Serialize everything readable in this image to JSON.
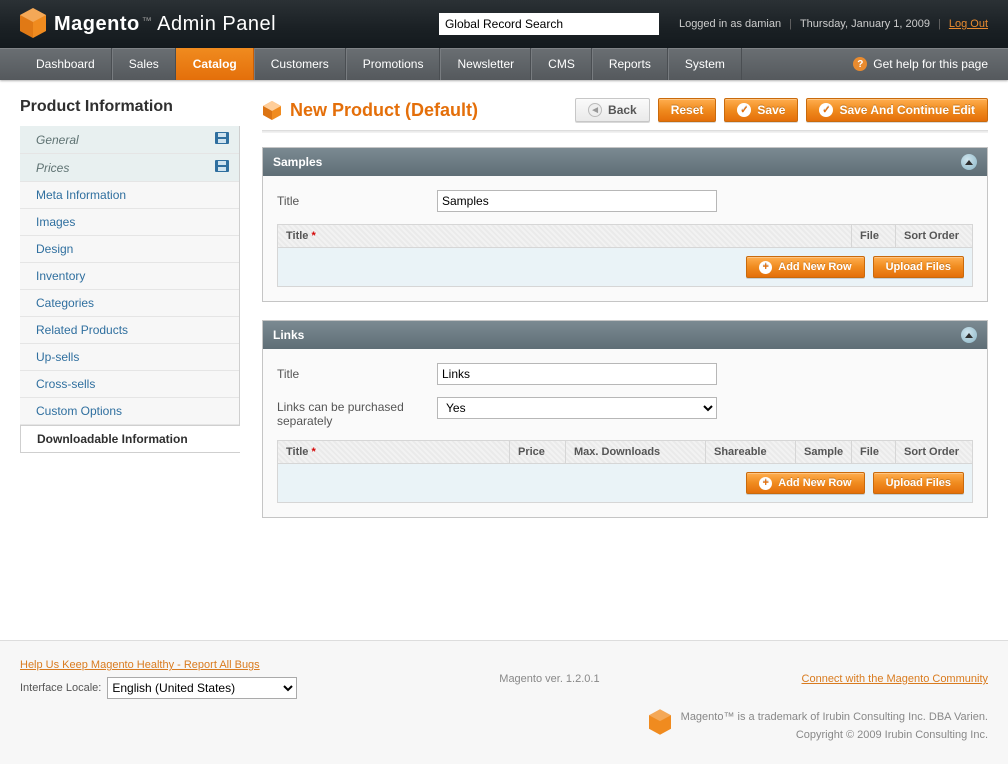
{
  "header": {
    "brand_main": "Magento",
    "brand_sub": "Admin Panel",
    "tm": "™",
    "search_placeholder": "Global Record Search",
    "logged_in_prefix": "Logged in as ",
    "user": "damian",
    "date": "Thursday, January 1, 2009",
    "logout": "Log Out"
  },
  "nav": {
    "items": [
      "Dashboard",
      "Sales",
      "Catalog",
      "Customers",
      "Promotions",
      "Newsletter",
      "CMS",
      "Reports",
      "System"
    ],
    "active_index": 2,
    "help": "Get help for this page"
  },
  "sidebar": {
    "heading": "Product Information",
    "tabs": [
      {
        "label": "General",
        "variant": "top",
        "disk": true
      },
      {
        "label": "Prices",
        "variant": "top",
        "disk": true
      },
      {
        "label": "Meta Information",
        "variant": "normal"
      },
      {
        "label": "Images",
        "variant": "normal"
      },
      {
        "label": "Design",
        "variant": "normal"
      },
      {
        "label": "Inventory",
        "variant": "normal"
      },
      {
        "label": "Categories",
        "variant": "normal"
      },
      {
        "label": "Related Products",
        "variant": "normal"
      },
      {
        "label": "Up-sells",
        "variant": "normal"
      },
      {
        "label": "Cross-sells",
        "variant": "normal"
      },
      {
        "label": "Custom Options",
        "variant": "normal"
      },
      {
        "label": "Downloadable Information",
        "variant": "active"
      }
    ]
  },
  "page": {
    "title": "New Product (Default)",
    "buttons": {
      "back": "Back",
      "reset": "Reset",
      "save": "Save",
      "save_continue": "Save And Continue Edit"
    }
  },
  "samples_panel": {
    "heading": "Samples",
    "title_label": "Title",
    "title_value": "Samples",
    "grid": {
      "cols": {
        "title": "Title",
        "file": "File",
        "sort": "Sort Order"
      },
      "add": "Add New Row",
      "upload": "Upload Files"
    }
  },
  "links_panel": {
    "heading": "Links",
    "title_label": "Title",
    "title_value": "Links",
    "purchased_label": "Links can be purchased separately",
    "purchased_value": "Yes",
    "grid": {
      "cols": {
        "title": "Title",
        "price": "Price",
        "maxdl": "Max. Downloads",
        "shareable": "Shareable",
        "sample": "Sample",
        "file": "File",
        "sort": "Sort Order"
      },
      "add": "Add New Row",
      "upload": "Upload Files"
    }
  },
  "footer": {
    "bug_link": "Help Us Keep Magento Healthy - Report All Bugs",
    "locale_label": "Interface Locale:",
    "locale_value": "English (United States)",
    "version": "Magento ver. 1.2.0.1",
    "community_link": "Connect with the Magento Community",
    "trademark": "Magento™ is a trademark of Irubin Consulting Inc. DBA Varien.",
    "copyright": "Copyright © 2009 Irubin Consulting Inc."
  }
}
